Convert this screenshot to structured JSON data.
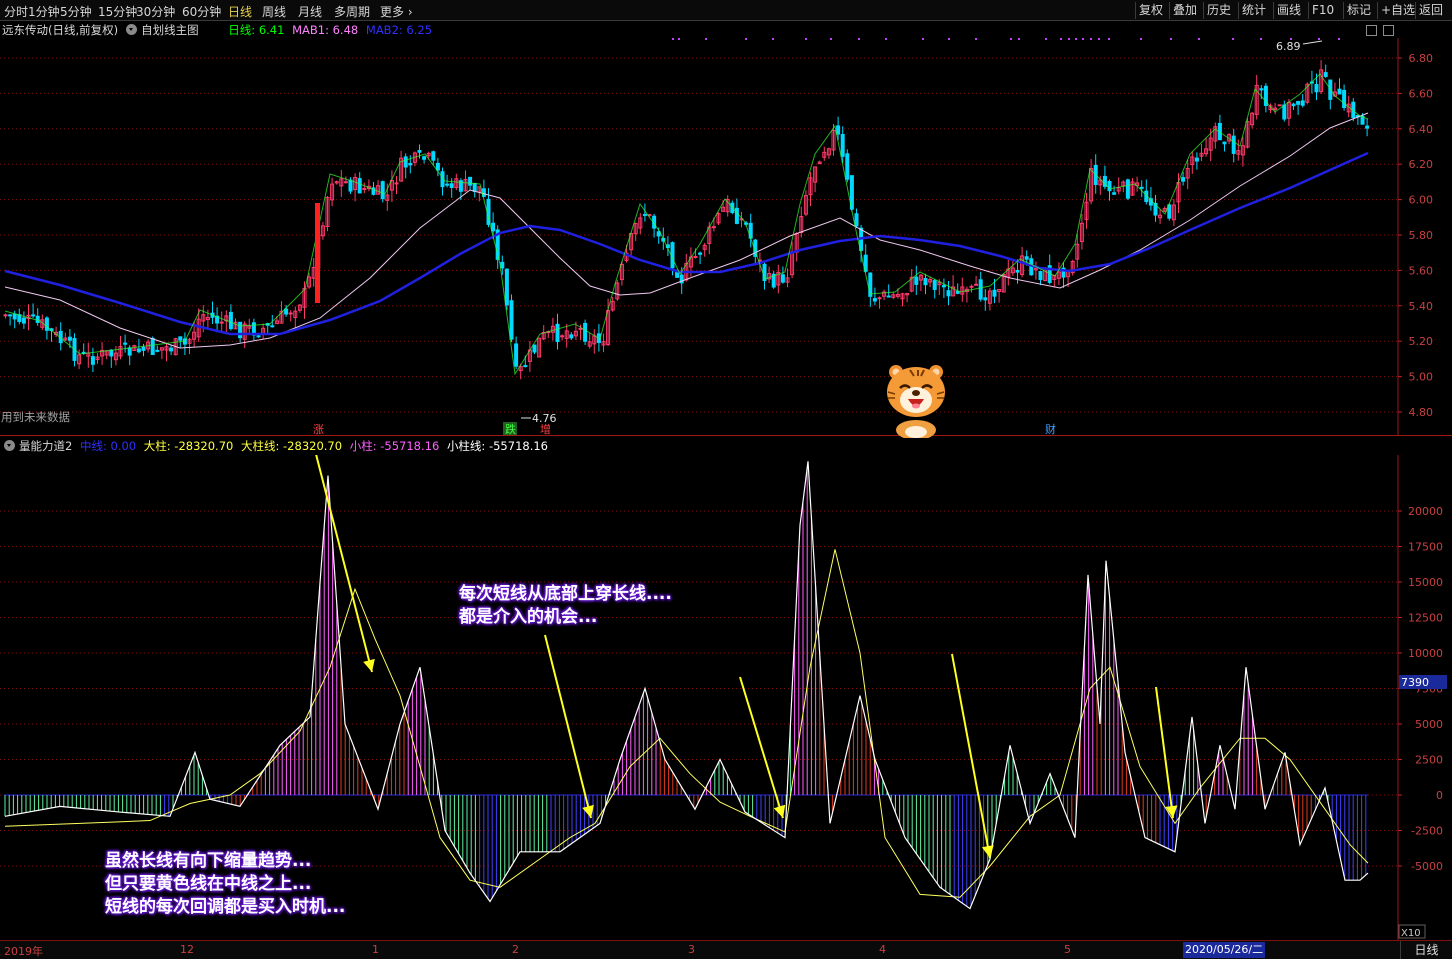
{
  "toolbar": {
    "periods": [
      "分时",
      "1分钟",
      "5分钟",
      "15分钟",
      "30分钟",
      "60分钟",
      "日线",
      "周线",
      "月线",
      "多周期",
      "更多"
    ],
    "active_period": "日线",
    "right_buttons": [
      "复权",
      "叠加",
      "历史",
      "统计",
      "画线",
      "F10",
      "标记",
      "+自选",
      "返回"
    ]
  },
  "main_panel": {
    "stock_label": "远东传动(日线,前复权)",
    "indicator_name": "自划线主图",
    "legend": [
      {
        "label": "日线: 6.41",
        "color": "#00ff00"
      },
      {
        "label": "MAB1: 6.48",
        "color": "#ff80ff"
      },
      {
        "label": "MAB2: 6.25",
        "color": "#3030ff"
      }
    ],
    "future_data_note": "用到未来数据",
    "price_ticks": [
      "6.80",
      "6.60",
      "6.40",
      "6.20",
      "6.00",
      "5.80",
      "5.60",
      "5.40",
      "5.20",
      "5.00",
      "4.80"
    ],
    "high_marker": "6.89",
    "low_marker": "4.76",
    "event_marks": [
      {
        "text": "涨",
        "color": "#ff4040"
      },
      {
        "text": "跌",
        "color": "#40ff40",
        "bg": "#206020"
      },
      {
        "text": "增",
        "color": "#ff4040"
      },
      {
        "text": "财",
        "color": "#40a0ff"
      }
    ]
  },
  "sub_panel": {
    "indicator_name": "量能力道2",
    "legend": [
      {
        "label": "中线: 0.00",
        "color": "#3030ff"
      },
      {
        "label": "大柱: -28320.70",
        "color": "#ffff40"
      },
      {
        "label": "大柱线: -28320.70",
        "color": "#ffff40"
      },
      {
        "label": "小柱: -55718.16",
        "color": "#ff60ff"
      },
      {
        "label": "小柱线: -55718.16",
        "color": "#ffffff"
      }
    ],
    "ticks": [
      "20000",
      "17500",
      "15000",
      "12500",
      "10000",
      "7500",
      "5000",
      "2500",
      "0",
      "-2500",
      "-5000"
    ],
    "cursor_value": "7390",
    "scale_label": "X10"
  },
  "annotations": {
    "callout_top": [
      "每次短线从底部上穿长线....",
      "都是介入的机会..."
    ],
    "callout_bottom": [
      "虽然长线有向下缩量趋势...",
      "但只要黄色线在中线之上...",
      "短线的每次回调都是买入时机..."
    ]
  },
  "x_axis": {
    "labels": [
      "2019年",
      "12",
      "1",
      "2",
      "3",
      "4",
      "5"
    ],
    "cursor_date": "2020/05/26/二"
  },
  "bottom_tab": "日线",
  "colors": {
    "up": "#ff3a6a",
    "down": "#00d8ff",
    "ma_long": "#2020e0",
    "ma_short": "#f0c8f0",
    "grid": "#801010"
  }
}
